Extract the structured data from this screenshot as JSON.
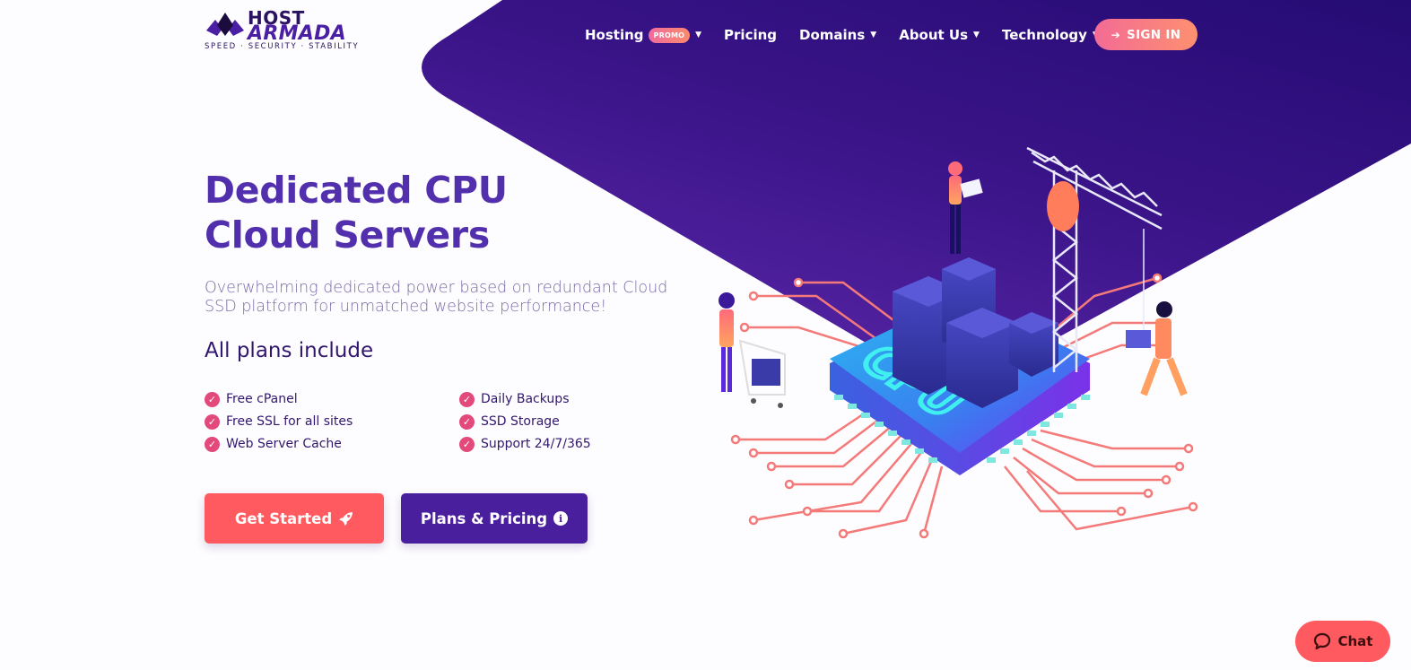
{
  "brand": {
    "name_line1": "HOST",
    "name_line2": "ARMADA",
    "tagline": "SPEED · SECURITY · STABILITY",
    "colors": {
      "primary_purple": "#4a1f9d",
      "heading_purple": "#5230ad",
      "dark_navy": "#2a0f78",
      "coral": "#ff5a5f",
      "pink_check": "#e4497c",
      "gradient_start": "#f36b95",
      "gradient_end": "#fd9070"
    }
  },
  "nav": {
    "items": [
      {
        "label": "Hosting",
        "badge": "PROMO",
        "dropdown": true
      },
      {
        "label": "Pricing",
        "dropdown": false
      },
      {
        "label": "Domains",
        "dropdown": true
      },
      {
        "label": "About Us",
        "dropdown": true
      },
      {
        "label": "Technology",
        "dropdown": true
      }
    ],
    "signin_label": "SIGN IN",
    "signin_icon": "sign-in-icon"
  },
  "hero": {
    "title_line1": "Dedicated CPU",
    "title_line2": "Cloud Servers",
    "subtitle_line1": "Overwhelming dedicated power based on redundant Cloud",
    "subtitle_line2": "SSD platform for unmatched website performance!",
    "plans_heading": "All plans include",
    "features": [
      "Free cPanel",
      "Daily Backups",
      "Free SSL for all sites",
      "SSD Storage",
      "Web Server Cache",
      "Support 24/7/365"
    ],
    "cta_primary": {
      "label": "Get Started",
      "icon": "rocket-icon"
    },
    "cta_secondary": {
      "label": "Plans & Pricing",
      "icon": "info-icon"
    },
    "illustration": {
      "chip_label": "CPU"
    }
  },
  "chat": {
    "label": "Chat",
    "icon": "chat-bubble-icon"
  }
}
